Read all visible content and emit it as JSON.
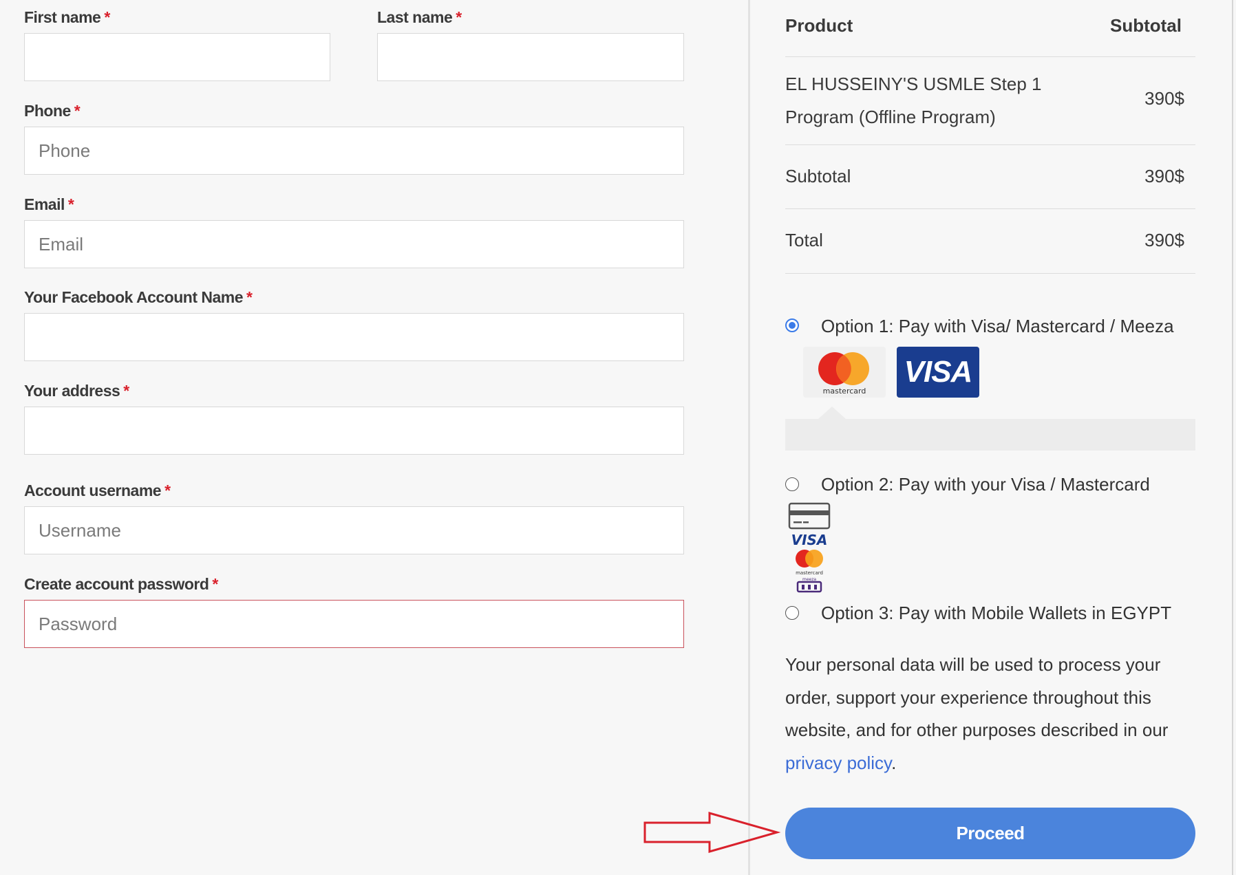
{
  "form": {
    "first_name": {
      "label": "First name",
      "required": "*",
      "value": ""
    },
    "last_name": {
      "label": "Last name",
      "required": "*",
      "value": ""
    },
    "phone": {
      "label": "Phone",
      "required": "*",
      "placeholder": "Phone"
    },
    "email": {
      "label": "Email",
      "required": "*",
      "placeholder": "Email"
    },
    "facebook": {
      "label": "Your Facebook Account Name",
      "required": "*",
      "value": ""
    },
    "address": {
      "label": "Your address",
      "required": "*",
      "value": ""
    },
    "username": {
      "label": "Account username",
      "required": "*",
      "placeholder": "Username"
    },
    "password": {
      "label": "Create account password",
      "required": "*",
      "placeholder": "Password"
    }
  },
  "order": {
    "col_product": "Product",
    "col_subtotal": "Subtotal",
    "product_line1": "EL HUSSEINY'S USMLE Step 1",
    "product_line2": "Program (Offline Program)",
    "product_price": "390$",
    "subtotal_label": "Subtotal",
    "subtotal_value": "390$",
    "total_label": "Total",
    "total_value": "390$"
  },
  "payment": {
    "option1": "Option 1: Pay with Visa/ Mastercard / Meeza",
    "option2": "Option 2: Pay with your Visa / Mastercard",
    "option3": "Option 3: Pay with Mobile Wallets in EGYPT",
    "selected": "option1",
    "mastercard_text": "mastercard",
    "visa_text": "VISA",
    "small_visa_text": "VISA",
    "small_mastercard_text": "mastercard",
    "meeza_text": "meeza"
  },
  "privacy": {
    "text": "Your personal data will be used to process your order, support your experience throughout this website, and for other purposes described in our ",
    "link": "privacy policy",
    "tail": "."
  },
  "proceed_label": "Proceed",
  "colors": {
    "accent": "#4b84dc",
    "required": "#d9212c",
    "link": "#3b6cd6",
    "annotation_arrow": "#d9212c"
  }
}
